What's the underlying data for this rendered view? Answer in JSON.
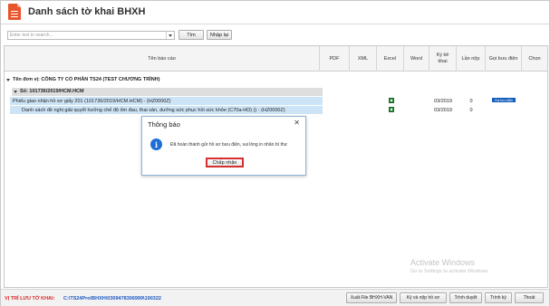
{
  "window": {
    "title": "Danh sách tờ khai BHXH"
  },
  "toolbar": {
    "search_placeholder": "Enter text to search...",
    "search_label": "Tìm",
    "reset_label": "Nhập lại"
  },
  "table": {
    "columns": [
      "Tên báo cáo",
      "PDF",
      "XML",
      "Excel",
      "Word",
      "Kỳ kê khai",
      "Lần nộp",
      "Gọi bưu điện",
      "Chọn"
    ],
    "group_unit": "Tên đơn vị: CÔNG TY CỔ PHẦN TS24 (TEST CHƯƠNG TRÌNH)",
    "group_doc": "Số: 101736/2019/HCM.HCM",
    "rows": [
      {
        "name": "Phiếu giao nhận hồ sơ giấy 201 (101736/2019/HCM.HCM) - (HZ0000Z)",
        "excel_icon": "excel-file-icon",
        "period": "03/2019",
        "submissions": "0",
        "post_badge": "Gọi bưu điện"
      },
      {
        "name": "Danh sách đề nghị giải quyết hưởng chế độ ốm đau, thai sản, dưỡng sức phục hồi sức khỏe (C70a-HD) () - (HZ0000Z)",
        "excel_icon": "excel-file-icon",
        "period": "03/2019",
        "submissions": "0",
        "post_badge": ""
      }
    ]
  },
  "dialog": {
    "title": "Thông báo",
    "message": "Đã hoàn thành gửi hồ sơ bưu điện, vui lòng in nhãn bì thư",
    "ok_label": "Chấp nhận",
    "close_glyph": "✕",
    "info_glyph": "i"
  },
  "footer": {
    "save_label": "VỊ TRÍ LƯU TỜ KHAI:",
    "save_path": "C:\\TS24Pro\\BHXH\\0309478306999\\190322",
    "buttons": [
      "Xuất File BHXH-VAN",
      "Ký và nộp hồ sơ",
      "Trình duyệt",
      "Trình ký",
      "Thoát"
    ]
  },
  "watermark": {
    "title": "Activate Windows",
    "subtitle": "Go to Settings to activate Windows."
  },
  "colors": {
    "accent": "#1d6fd6",
    "selection": "#cde4f7",
    "danger": "#d62f2f",
    "path": "#1b57c2"
  }
}
